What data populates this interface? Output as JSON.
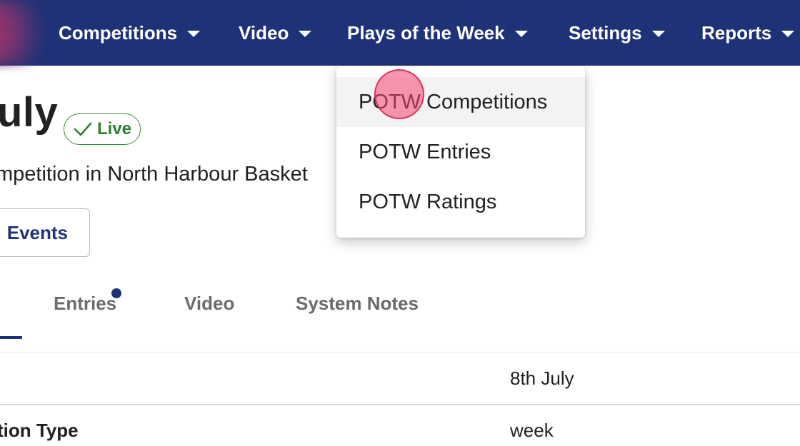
{
  "nav": {
    "items": [
      {
        "label": "Competitions"
      },
      {
        "label": "Video"
      },
      {
        "label": "Plays of the Week"
      },
      {
        "label": "Settings"
      },
      {
        "label": "Reports"
      }
    ]
  },
  "page": {
    "title": "uly",
    "status_badge": "Live",
    "subtitle": "mpetition in North Harbour Basket",
    "events_button": "Events"
  },
  "tabs": [
    {
      "label": "Entries",
      "has_notification_dot": true
    },
    {
      "label": "Video"
    },
    {
      "label": "System Notes"
    }
  ],
  "details": {
    "rows": [
      {
        "label": "",
        "value": "8th July"
      },
      {
        "label": "tion Type",
        "value": "week"
      }
    ]
  },
  "dropdown": {
    "items": [
      {
        "label": "POTW Competitions",
        "hovered": true
      },
      {
        "label": "POTW Entries"
      },
      {
        "label": "POTW Ratings"
      }
    ]
  },
  "colors": {
    "nav_bg": "#1f3277",
    "live_green": "#2e7d32",
    "accent": "#1f3277"
  }
}
